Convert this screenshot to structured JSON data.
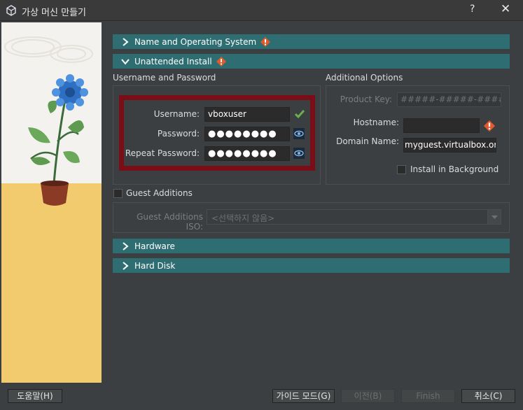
{
  "window": {
    "title": "가상 머신 만들기",
    "help_label": "?",
    "close_label": "✕"
  },
  "sections": {
    "name_os": "Name and Operating System",
    "unattended": "Unattended Install",
    "hardware": "Hardware",
    "hard_disk": "Hard Disk"
  },
  "user_group": {
    "title": "Username and Password",
    "username_label": "Username:",
    "username_value": "vboxuser",
    "password_label": "Password:",
    "password_value": "●●●●●●●●",
    "repeat_label": "Repeat Password:",
    "repeat_value": "●●●●●●●●"
  },
  "options_group": {
    "title": "Additional Options",
    "product_key_label": "Product Key:",
    "product_key_placeholder": "#####-#####-#####-#####-#####",
    "hostname_label": "Hostname:",
    "hostname_value": "",
    "domain_label": "Domain Name:",
    "domain_value": "myguest.virtualbox.org",
    "install_bg_label": "Install in Background"
  },
  "guest_additions": {
    "checkbox_label": "Guest Additions",
    "iso_label": "Guest Additions ISO:",
    "iso_value": "<선택하지 않음>"
  },
  "buttons": {
    "help": "도움말(H)",
    "guide_mode": "가이드 모드(G)",
    "back": "이전(B)",
    "finish": "Finish",
    "cancel": "취소(C)"
  },
  "colors": {
    "section_bar": "#2e6e72",
    "highlight": "#7a0d16",
    "warning": "#e05a2b",
    "ok_check": "#6ab04c"
  }
}
